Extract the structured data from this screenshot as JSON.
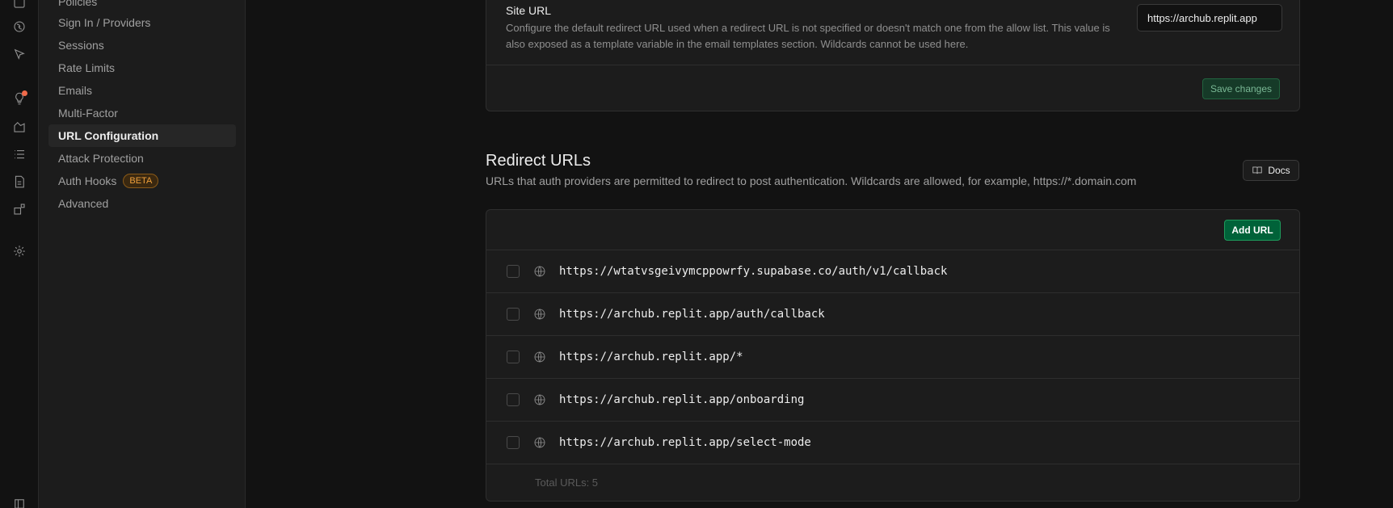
{
  "sidebar": {
    "items": [
      {
        "label": "Policies"
      },
      {
        "label": "Sign In / Providers"
      },
      {
        "label": "Sessions"
      },
      {
        "label": "Rate Limits"
      },
      {
        "label": "Emails"
      },
      {
        "label": "Multi-Factor"
      },
      {
        "label": "URL Configuration"
      },
      {
        "label": "Attack Protection"
      },
      {
        "label": "Auth Hooks",
        "badge": "BETA"
      },
      {
        "label": "Advanced"
      }
    ],
    "active": "URL Configuration"
  },
  "rail": {
    "icons": [
      "table-icon",
      "database-icon",
      "cursor-icon",
      "lightbulb-icon",
      "chart-icon",
      "list-icon",
      "document-icon",
      "integrations-icon",
      "settings-icon",
      "panel-toggle-icon"
    ]
  },
  "site_url": {
    "title": "Site URL",
    "description": "Configure the default redirect URL used when a redirect URL is not specified or doesn't match one from the allow list. This value is also exposed as a template variable in the email templates section. Wildcards cannot be used here.",
    "value": "https://archub.replit.app",
    "save_label": "Save changes"
  },
  "redirect_urls": {
    "title": "Redirect URLs",
    "description": "URLs that auth providers are permitted to redirect to post authentication. Wildcards are allowed, for example, https://*.domain.com",
    "docs_label": "Docs",
    "add_label": "Add URL",
    "urls": [
      "https://wtatvsgeivymcppowrfy.supabase.co/auth/v1/callback",
      "https://archub.replit.app/auth/callback",
      "https://archub.replit.app/*",
      "https://archub.replit.app/onboarding",
      "https://archub.replit.app/select-mode"
    ],
    "total_label": "Total URLs: 5"
  },
  "colors": {
    "accent": "#006239",
    "beta": "#f0a13c",
    "notification": "#f06a4a"
  }
}
